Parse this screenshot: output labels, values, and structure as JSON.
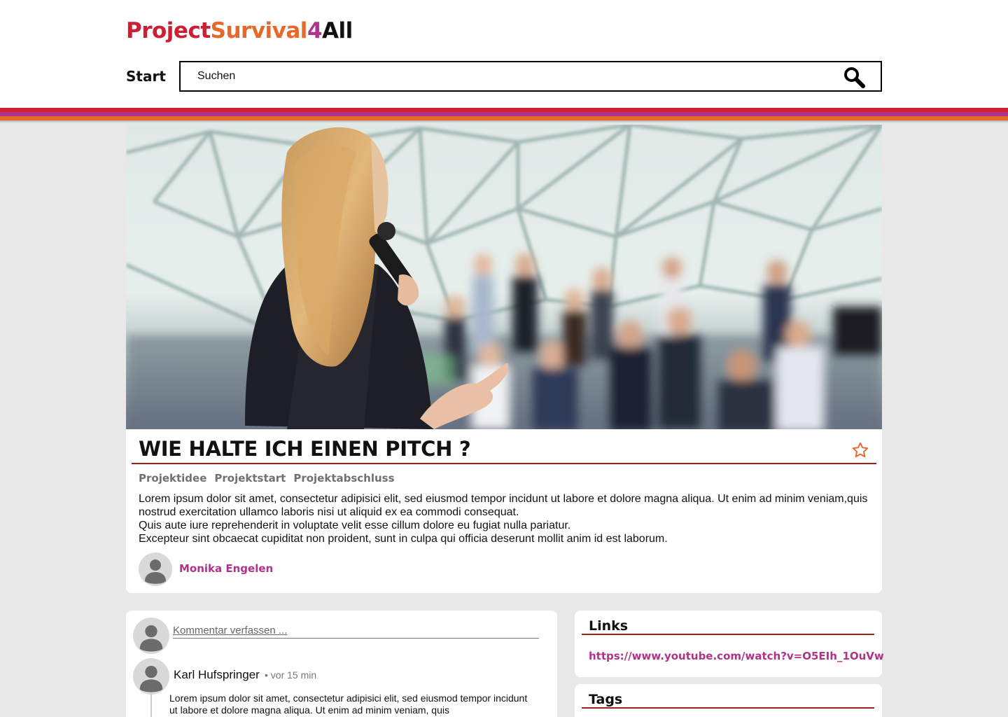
{
  "header": {
    "logo": {
      "part1": "Project",
      "part2": "Survival",
      "part3": "4",
      "part4": "All"
    },
    "nav_start": "Start",
    "search": {
      "placeholder": "Suchen"
    }
  },
  "theme": {
    "red": "#cc1f33",
    "magenta": "#b0338b",
    "orange": "#e8682a",
    "rule": "#a02020",
    "background": "#e8e8e8"
  },
  "icons": [
    "search-icon",
    "star-icon",
    "avatar-icon"
  ],
  "article": {
    "title": "WIE HALTE ICH EINEN PITCH ?",
    "categories": [
      "Projektidee",
      "Projektstart",
      "Projektabschluss"
    ],
    "body": [
      "Lorem ipsum dolor sit amet, consectetur adipisici elit, sed eiusmod  tempor incidunt ut labore et dolore magna aliqua. Ut enim ad minim veniam,quis nostrud exercitation ullamco laboris nisi ut aliquid ex ea  commodi consequat.",
      "Quis aute iure reprehenderit in voluptate velit esse  cillum dolore eu fugiat nulla pariatur.",
      "Excepteur sint obcaecat  cupiditat non proident, sunt in culpa qui officia deserunt mollit anim  id est laborum."
    ],
    "author": "Monika Engelen"
  },
  "comments": {
    "input_placeholder": "Kommentar verfassen ...",
    "items": [
      {
        "author": "Karl Hufspringer",
        "time": "• vor 15 min",
        "text": "Lorem ipsum dolor sit amet, consectetur adipisici elit, sed eiusmod  tempor incidunt ut labore et dolore magna aliqua. Ut enim ad minim  veniam, quis"
      }
    ]
  },
  "links": {
    "title": "Links",
    "items": [
      "https://www.youtube.com/watch?v=O5EIh_1OuVw"
    ]
  },
  "tags": {
    "title": "Tags"
  }
}
